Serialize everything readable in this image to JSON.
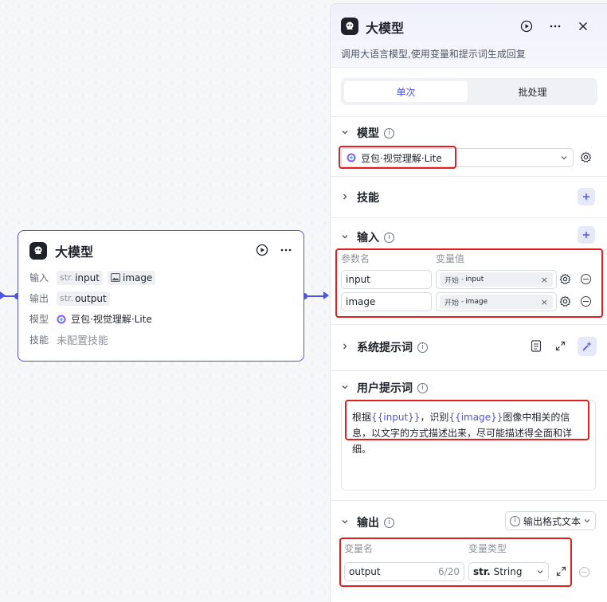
{
  "node": {
    "title": "大模型",
    "input_label": "输入",
    "output_label": "输出",
    "model_label": "模型",
    "skill_label": "技能",
    "input_chip_prefix": "str.",
    "input_chip": "input",
    "image_chip": "image",
    "output_chip_prefix": "str.",
    "output_chip": "output",
    "model_name": "豆包·视觉理解·Lite",
    "skill_value": "未配置技能"
  },
  "panel": {
    "title": "大模型",
    "description": "调用大语言模型,使用变量和提示词生成回复",
    "tabs": [
      {
        "label": "单次"
      },
      {
        "label": "批处理"
      }
    ],
    "model_section": {
      "title": "模型",
      "selected": "豆包·视觉理解·Lite"
    },
    "skill_section": {
      "title": "技能"
    },
    "input_section": {
      "title": "输入",
      "col_name": "参数名",
      "col_value": "变量值",
      "rows": [
        {
          "name": "input",
          "source": "开始",
          "dash": "-",
          "var": "input"
        },
        {
          "name": "image",
          "source": "开始",
          "dash": "-",
          "var": "image"
        }
      ]
    },
    "system_prompt_section": {
      "title": "系统提示词"
    },
    "user_prompt_section": {
      "title": "用户提示词",
      "text_1": "根据",
      "var_1": "{{input}}",
      "text_2": "，识别",
      "var_2": "{{image}}",
      "text_3": "图像中相关的信息，以文字的方式描述出来，尽可能描述得全面和详细。"
    },
    "output_section": {
      "title": "输出",
      "format_label": "输出格式",
      "format_value": "文本",
      "col_name": "变量名",
      "col_type": "变量类型",
      "var_name": "output",
      "char_count": "6/20",
      "type_prefix": "str.",
      "type_value": "String"
    }
  },
  "colors": {
    "accent": "#4d53e8",
    "highlight": "#e02020"
  }
}
